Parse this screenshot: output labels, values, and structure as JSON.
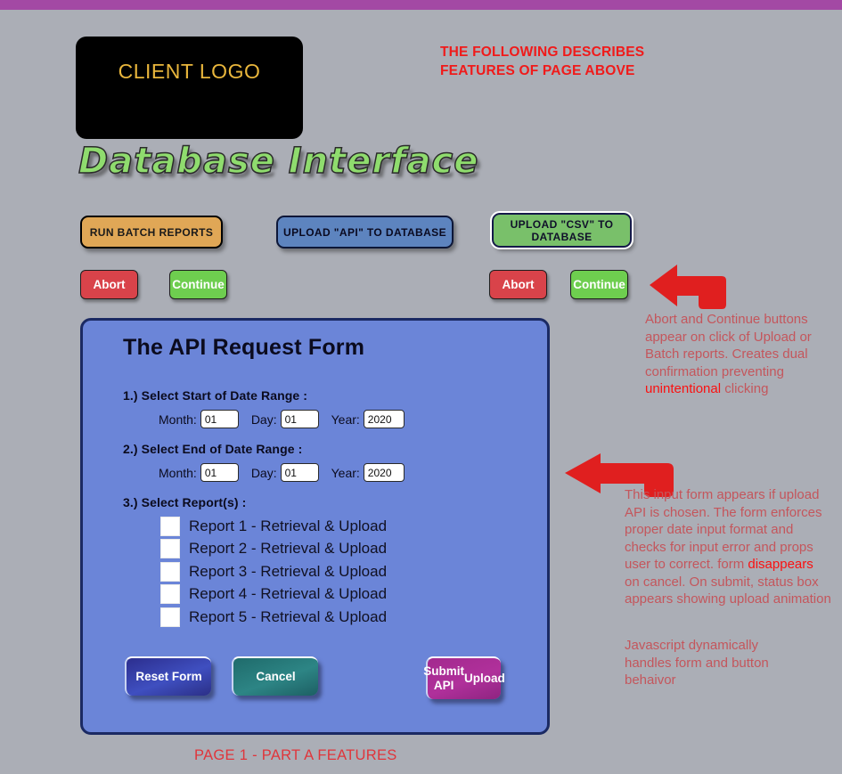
{
  "theme": {
    "background": "#abaeb6",
    "top_bar": "#a349a4",
    "panel_blue": "#6b85d8",
    "annotation_red": "#c4565c",
    "highlight_red": "#fa1111",
    "title_green": "#8fdc6e",
    "logo_gold": "#e9b63c"
  },
  "logo": {
    "text": "CLIENT LOGO"
  },
  "header_note": {
    "line1": "THE FOLLOWING DESCRIBES",
    "line2": "FEATURES OF PAGE ABOVE"
  },
  "page_title": "Database Interface",
  "main_buttons": [
    {
      "label": "RUN BATCH REPORTS"
    },
    {
      "label": "UPLOAD \"API\" TO DATABASE"
    },
    {
      "label": "UPLOAD \"CSV\" TO DATABASE"
    }
  ],
  "confirm_buttons": {
    "abort_label": "Abort",
    "continue_label": "Continue"
  },
  "form": {
    "title": "The API Request Form",
    "step1_label": "1.) Select Start of Date Range :",
    "step2_label": "2.) Select End of Date Range :",
    "step3_label": "3.) Select Report(s) :",
    "field_labels": {
      "month": "Month:",
      "day": "Day:",
      "year": "Year:"
    },
    "start_date": {
      "month": "01",
      "day": "01",
      "year": "2020"
    },
    "end_date": {
      "month": "01",
      "day": "01",
      "year": "2020"
    },
    "reports": [
      "Report 1 - Retrieval & Upload",
      "Report 2 - Retrieval & Upload",
      "Report 3 - Retrieval & Upload",
      "Report 4 - Retrieval & Upload",
      "Report 5 - Retrieval & Upload"
    ],
    "buttons": {
      "reset": "Reset Form",
      "cancel": "Cancel",
      "submit_line1": "Submit API",
      "submit_line2": "Upload"
    }
  },
  "annotations": {
    "one": {
      "before": "Abort and Continue buttons appear on click of Upload or Batch reports. Creates dual confirmation preventing ",
      "highlight": "unintentional",
      "after": " clicking"
    },
    "two": {
      "before": "This input form appears if upload API is chosen. The form enforces proper date input format and checks for input error and props user to correct. form ",
      "highlight": "disappears",
      "after": " on cancel. On submit, status box appears showing upload animation"
    },
    "three": {
      "text": "Javascript dynamically handles form and button behaivor"
    }
  },
  "footer_caption": "PAGE 1 - PART A FEATURES"
}
